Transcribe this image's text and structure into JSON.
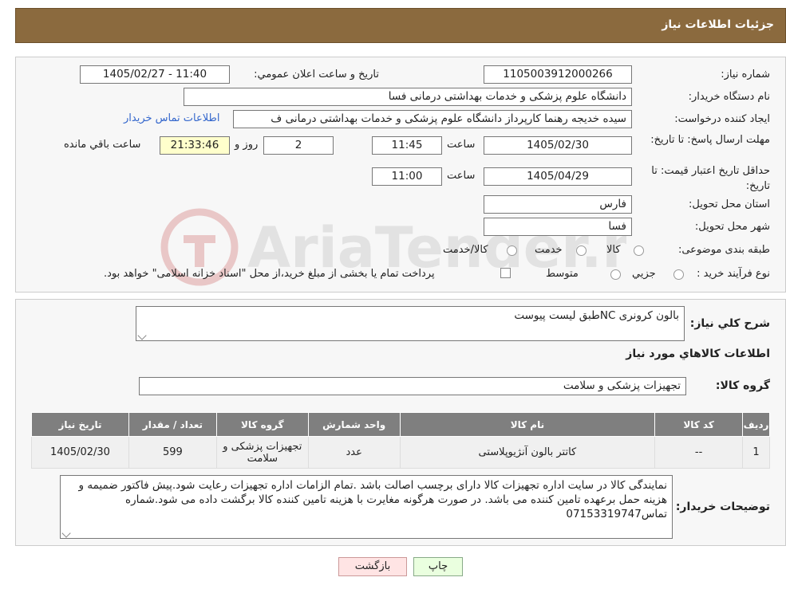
{
  "header": {
    "title": "جزئیات اطلاعات نیاز"
  },
  "form": {
    "need_number_label": "شماره نیاز:",
    "need_number": "1105003912000266",
    "announce_label": "تاریخ و ساعت اعلان عمومي:",
    "announce_value": "1405/02/27 - 11:40",
    "buyer_org_label": "نام دستگاه خريدار:",
    "buyer_org": "دانشگاه علوم پزشکی و خدمات بهداشتی درمانی فسا",
    "creator_label": "ايجاد کننده درخواست:",
    "creator": "سیده خدیجه رهنما کارپرداز دانشگاه علوم پزشکی و خدمات بهداشتی درمانی ف",
    "contact_link": "اطلاعات تماس خريدار",
    "reply_deadline_label": "مهلت ارسال پاسخ: تا تاريخ:",
    "reply_date": "1405/02/30",
    "time_label": "ساعت",
    "reply_time": "11:45",
    "days_value": "2",
    "days_label": "روز و",
    "remaining_value": "21:33:46",
    "remaining_label": "ساعت باقي مانده",
    "price_validity_label": "حداقل تاريخ اعتبار قيمت: تا تاريخ:",
    "price_date": "1405/04/29",
    "price_time": "11:00",
    "province_label": "استان محل تحويل:",
    "province": "فارس",
    "city_label": "شهر محل تحويل:",
    "city": "فسا",
    "category_label": "طبقه بندی موضوعی:",
    "category_options": [
      "كالا",
      "خدمت",
      "كالا/خدمت"
    ],
    "process_label": "نوع فرآيند خريد :",
    "process_options": [
      "جزيي",
      "متوسط"
    ],
    "process_note": "پرداخت تمام يا بخشی از مبلغ خريد،از محل \"اسناد خزانه اسلامی\" خواهد بود."
  },
  "summary": {
    "label": "شرح كلي نياز:",
    "value": "بالون کرونری NCطبق لیست پیوست",
    "goods_info_title": "اطلاعات كالاهاي مورد نياز",
    "group_label": "گروه كالا:",
    "group_value": "تجهیزات پزشکی و سلامت"
  },
  "table": {
    "headers": [
      "رديف",
      "كد كالا",
      "نام كالا",
      "واحد شمارش",
      "گروه كالا",
      "تعداد / مقدار",
      "تاريخ نياز"
    ],
    "rows": [
      [
        "1",
        "--",
        "کاتتر بالون آنژیوپلاستی",
        "عدد",
        "تجهیزات پزشکی و سلامت",
        "599",
        "1405/02/30"
      ]
    ]
  },
  "notes": {
    "label": "توضيحات خريدار:",
    "value": "نمایندگی کالا در سایت اداره تجهیزات کالا دارای برچسب اصالت  باشد .تمام الزامات اداره تجهیزات رعایت شود.پیش فاکتور ضمیمه و هزینه  حمل برعهده تامین کننده می باشد. در صورت هرگونه مغایرت با هزینه تامین کننده کالا برگشت داده می شود.شماره تماس07153319747"
  },
  "buttons": {
    "print": "چاپ",
    "back": "بازگشت"
  },
  "watermark": "AriaTender.neT",
  "colors": {
    "header": "#8b6a3e",
    "table_header": "#7f7f7f",
    "yellow": "#ffffcc",
    "link": "#3366cc",
    "print_bg": "#eaffdf",
    "back_bg": "#ffe4e4"
  }
}
